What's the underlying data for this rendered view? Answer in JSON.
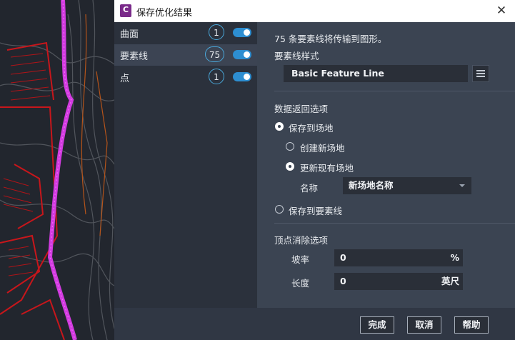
{
  "window": {
    "title": "保存优化结果",
    "app_icon_letter": "C"
  },
  "sidebar": {
    "items": [
      {
        "label": "曲面",
        "count": "1",
        "enabled": true
      },
      {
        "label": "要素线",
        "count": "75",
        "enabled": true
      },
      {
        "label": "点",
        "count": "1",
        "enabled": true
      }
    ]
  },
  "main": {
    "summary": "75 条要素线将传输到图形。",
    "style_label": "要素线样式",
    "style_value": "Basic Feature Line",
    "return_section_label": "数据返回选项",
    "save_to_site_label": "保存到场地",
    "create_new_site_label": "创建新场地",
    "update_existing_site_label": "更新现有场地",
    "name_label": "名称",
    "name_value": "新场地名称",
    "save_to_feature_line_label": "保存到要素线",
    "vertex_section_label": "顶点消除选项",
    "slope_label": "坡率",
    "slope_value": "0",
    "slope_unit": "%",
    "length_label": "长度",
    "length_value": "0",
    "length_unit": "英尺"
  },
  "footer": {
    "done_label": "完成",
    "cancel_label": "取消",
    "help_label": "帮助"
  },
  "colors": {
    "accent": "#2d8ed1",
    "dialog_bg": "#3b4452",
    "sidebar_bg": "#2b313c"
  }
}
